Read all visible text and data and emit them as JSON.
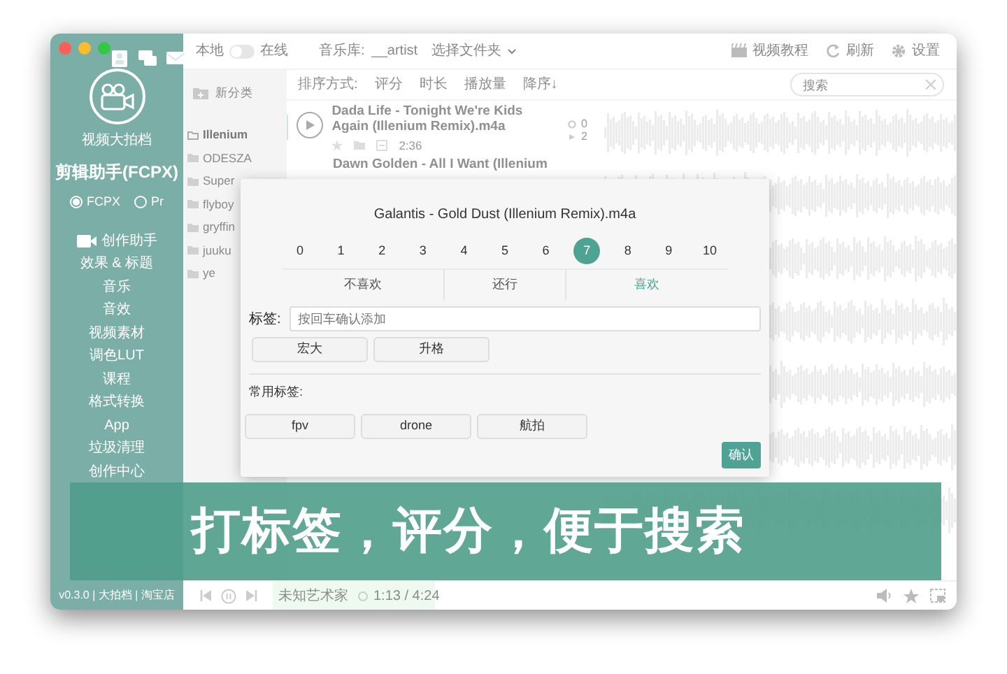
{
  "sidebar": {
    "header_icons": [
      {
        "kind": "person"
      },
      {
        "kind": "chat"
      },
      {
        "kind": "mail"
      }
    ],
    "subtitle": "视频大拍档",
    "title": "剪辑助手(FCPX)",
    "modes": [
      {
        "label": "FCPX",
        "selected": true
      },
      {
        "label": "Pr",
        "selected": false
      }
    ],
    "items": [
      {
        "label": "创作助手",
        "kind": "camera"
      },
      {
        "label": "效果 & 标题",
        "kind": "plain"
      },
      {
        "label": "音乐",
        "kind": "plain"
      },
      {
        "label": "音效",
        "kind": "plain"
      },
      {
        "label": "视频素材",
        "kind": "plain"
      },
      {
        "label": "调色LUT",
        "kind": "plain"
      },
      {
        "label": "课程",
        "kind": "plain"
      },
      {
        "label": "格式转换",
        "kind": "plain"
      },
      {
        "label": "App",
        "kind": "plain"
      },
      {
        "label": "垃圾清理",
        "kind": "plain"
      },
      {
        "label": "创作中心",
        "kind": "plain"
      }
    ],
    "footer": "v0.3.0 | 大拍档 | 淘宝店"
  },
  "topbar": {
    "source_left": "本地",
    "source_on": false,
    "source_right": "在线",
    "library_label": "音乐库:",
    "library_value": "__artist",
    "folder_select": "选择文件夹",
    "actions": [
      {
        "label": "视频教程",
        "kind": "video"
      },
      {
        "label": "刷新",
        "kind": "refresh"
      },
      {
        "label": "设置",
        "kind": "gear"
      }
    ]
  },
  "categories": {
    "new_button": "新分类",
    "items": [
      {
        "label": "Illenium",
        "selected": true
      },
      {
        "label": "ODESZA",
        "selected": false
      },
      {
        "label": "Super",
        "selected": false
      },
      {
        "label": "flyboy",
        "selected": false
      },
      {
        "label": "gryffin",
        "selected": false
      },
      {
        "label": "juuku",
        "selected": false
      },
      {
        "label": "ye",
        "selected": false
      }
    ]
  },
  "sort_bar": {
    "label": "排序方式:",
    "options": [
      "评分",
      "时长",
      "播放量",
      "降序↓"
    ],
    "search": {
      "placeholder": "搜索"
    }
  },
  "tracks": [
    {
      "title": "Dada Life - Tonight We're Kids Again (Illenium Remix).m4a",
      "duration": "2:36",
      "score": "0",
      "plays": "2"
    },
    {
      "title": "Dawn Golden - All I Want (Illenium"
    }
  ],
  "player": {
    "artist": "未知艺术家",
    "time": "1:13 / 4:24",
    "level": 0.27
  },
  "dialog": {
    "title": "Galantis - Gold Dust (Illenium Remix).m4a",
    "scores": [
      {
        "label": "0",
        "selected": false
      },
      {
        "label": "1",
        "selected": false
      },
      {
        "label": "2",
        "selected": false
      },
      {
        "label": "3",
        "selected": false
      },
      {
        "label": "4",
        "selected": false
      },
      {
        "label": "5",
        "selected": false
      },
      {
        "label": "6",
        "selected": false
      },
      {
        "label": "7",
        "selected": true
      },
      {
        "label": "8",
        "selected": false
      },
      {
        "label": "9",
        "selected": false
      },
      {
        "label": "10",
        "selected": false
      }
    ],
    "moods": [
      {
        "label": "不喜欢",
        "selected": false
      },
      {
        "label": "还行",
        "selected": false
      },
      {
        "label": "喜欢",
        "selected": true
      }
    ],
    "tag_label": "标签:",
    "tag_field": {
      "placeholder": "按回车确认添加"
    },
    "tags": [
      "宏大",
      "升格"
    ],
    "common_label": "常用标签:",
    "common_tags": [
      "fpv",
      "drone",
      "航拍"
    ],
    "confirm": "确认"
  },
  "banner": "打标签，评分，便于搜索"
}
